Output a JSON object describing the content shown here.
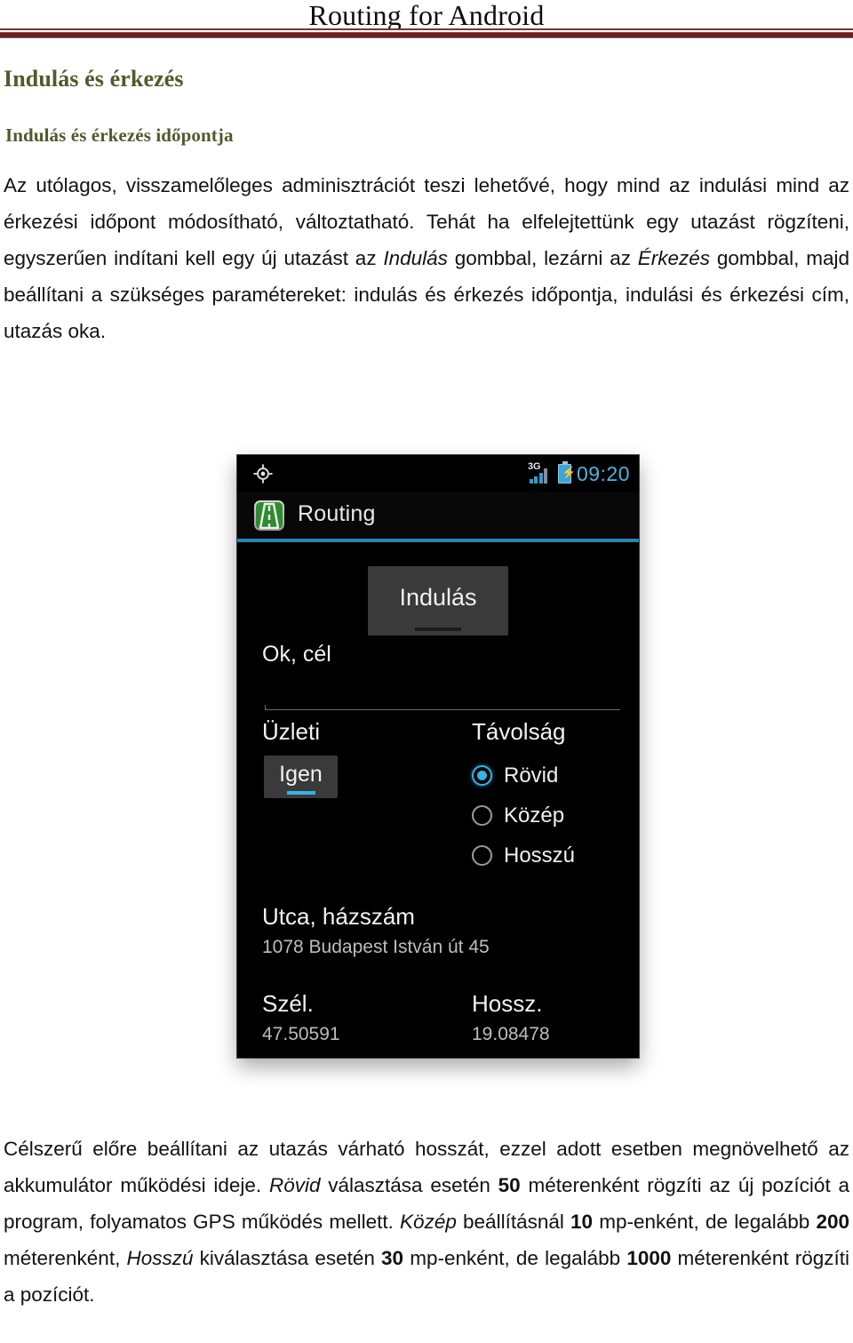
{
  "document": {
    "title": "Routing for Android",
    "heading1": "Indulás és érkezés",
    "heading2": "Indulás és érkezés időpontja",
    "paragraph1_html": "Az utólagos, visszamelőleges adminisztrációt teszi lehetővé, hogy mind az indulási mind az érkezési időpont módosítható, változtatható. Tehát ha elfelejtettünk egy utazást rögzíteni, egyszerűen indítani kell egy új utazást az <i>Indulás</i> gombbal, lezárni az <i>Érkezés</i> gombbal, majd beállítani a szükséges paramétereket: indulás és érkezés időpontja, indulási és érkezési cím, utazás oka.",
    "paragraph2_html": "Célszerű előre beállítani az utazás várható hosszát, ezzel adott esetben megnövelhető az akkumulátor működési ideje. <i>Rövid</i> választása esetén <b>50</b> méterenként rögzíti az új pozíciót a program, folyamatos GPS működés mellett. <i>Közép</i> beállításnál <b>10</b> mp-enként, de legalább <b>200</b> méterenként, <i>Hosszú</i> kiválasztása esetén <b>30</b> mp-enként, de legalább <b>1000</b> méterenként rögzíti a pozíciót.",
    "colors": {
      "heading": "#4f5b2b",
      "rule_thin": "#7b3236",
      "rule_thick": "#6a2125"
    }
  },
  "phone_screenshot": {
    "status_bar": {
      "gps_icon": "gps-crosshair-icon",
      "network_type": "3G",
      "signal_icon": "signal-bars-icon",
      "battery_icon": "battery-charging-icon",
      "time": "09:20",
      "time_color": "#4ab4e0"
    },
    "action_bar": {
      "app_icon": "motorway-icon",
      "title": "Routing",
      "accent_color": "#2c84ad"
    },
    "content": {
      "start_button_label": "Indulás",
      "status_text": "Ok, cél",
      "business_label": "Üzleti",
      "business_value": "Igen",
      "distance_label": "Távolság",
      "distance_options": [
        {
          "label": "Rövid",
          "selected": true
        },
        {
          "label": "Közép",
          "selected": false
        },
        {
          "label": "Hosszú",
          "selected": false
        }
      ],
      "fields": [
        {
          "title": "Utca, házszám",
          "value": "1078 Budapest István út 45"
        },
        {
          "title": "Szél.",
          "value": "47.50591"
        },
        {
          "title": "Hossz.",
          "value": "19.08478"
        }
      ],
      "accent_color": "#33b5e5"
    }
  }
}
